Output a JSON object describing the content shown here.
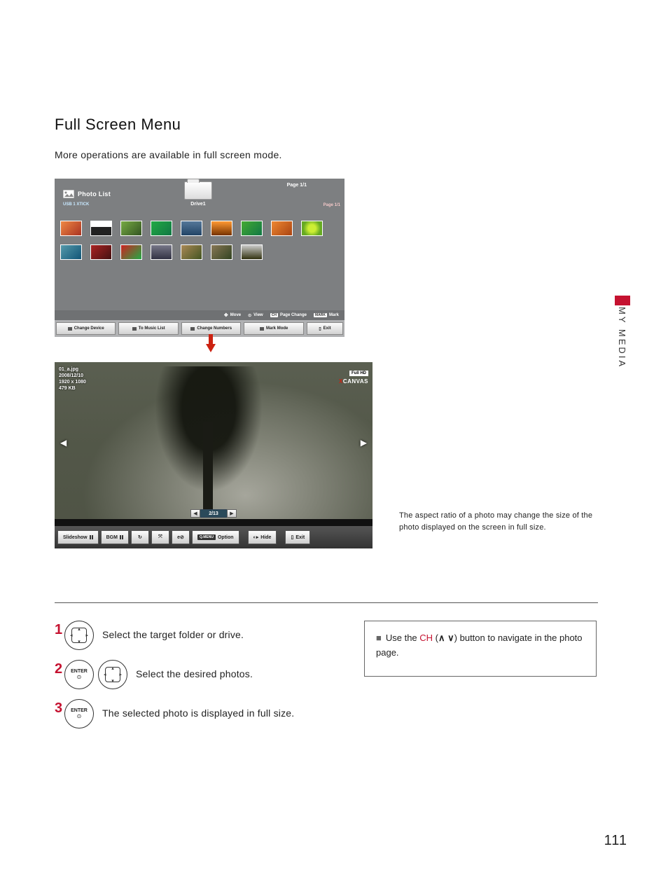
{
  "title": "Full Screen Menu",
  "intro": "More operations are available in full screen mode.",
  "side_tab": "MY MEDIA",
  "page_number": "111",
  "photo_list": {
    "heading": "Photo List",
    "usb_label": "USB 1 XTICK",
    "top_page": "Page 1/1",
    "right_page": "Page 1/1",
    "drive_tab": "Drive1",
    "hints": {
      "move": "Move",
      "view": "View",
      "page_change": "Page Change",
      "mark": "Mark",
      "ch_badge": "CH",
      "mark_badge": "MARK"
    },
    "buttons": {
      "change_device": "Change Device",
      "to_music_list": "To Music List",
      "change_numbers": "Change Numbers",
      "mark_mode": "Mark Mode",
      "exit": "Exit"
    }
  },
  "viewer": {
    "file_name": "01_a.jpg",
    "file_date": "2008/12/10",
    "file_res": "1920 x 1080",
    "file_size": "479 KB",
    "logo_hd": "Full HD",
    "logo_brand_prefix": "X",
    "logo_brand": "CANVAS",
    "pager": "2/13",
    "tools": {
      "slideshow": "Slideshow",
      "bgm": "BGM",
      "rotate": "↻",
      "zoom": "⤧",
      "bright": "e⊘",
      "qmenu_badge": "Q.MENU",
      "option": "Option",
      "hide": "Hide",
      "exit": "Exit"
    }
  },
  "side_note": "The aspect ratio of a photo may change the size of the photo displayed on the screen in full size.",
  "steps": {
    "s1": "Select the target folder or drive.",
    "s2": "Select the desired photos.",
    "s3": "The selected photo is displayed in full size.",
    "enter_label": "ENTER"
  },
  "tip": {
    "prefix": "Use the ",
    "ch": "CH",
    "mid": " (",
    "sym": "∧ ∨",
    "suffix": ") button to navigate in the photo page."
  }
}
